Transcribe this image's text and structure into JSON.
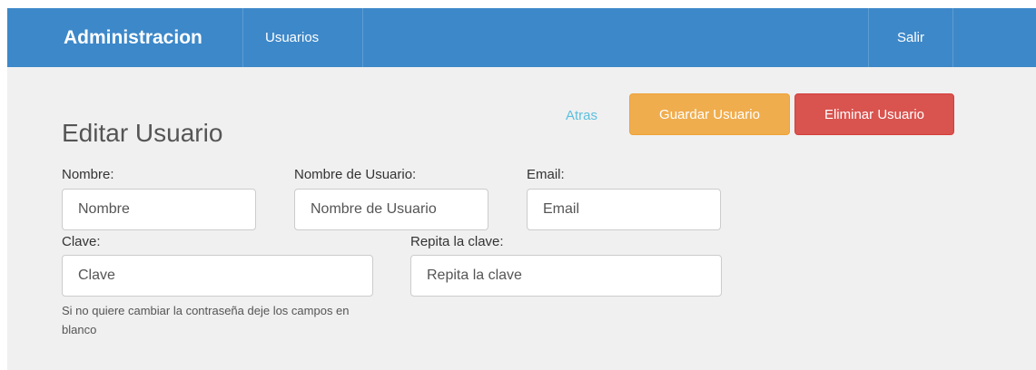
{
  "navbar": {
    "brand": "Administracion",
    "items": [
      {
        "label": "Usuarios"
      }
    ],
    "logout": "Salir"
  },
  "form": {
    "title": "Editar Usuario",
    "actions": {
      "back": "Atras",
      "save": "Guardar Usuario",
      "delete": "Eliminar Usuario"
    },
    "fields": {
      "nombre": {
        "label": "Nombre:",
        "placeholder": "Nombre"
      },
      "usuario": {
        "label": "Nombre de Usuario:",
        "placeholder": "Nombre de Usuario"
      },
      "email": {
        "label": "Email:",
        "placeholder": "Email"
      },
      "clave": {
        "label": "Clave:",
        "placeholder": "Clave"
      },
      "repetir": {
        "label": "Repita la clave:",
        "placeholder": "Repita la clave"
      }
    },
    "help": "Si no quiere cambiar la contraseña deje los campos en blanco"
  },
  "colors": {
    "navbar": "#3d88c9",
    "warning": "#f0ad4e",
    "danger": "#d9534f",
    "link": "#5bc0de",
    "background": "#f0f0f0"
  }
}
